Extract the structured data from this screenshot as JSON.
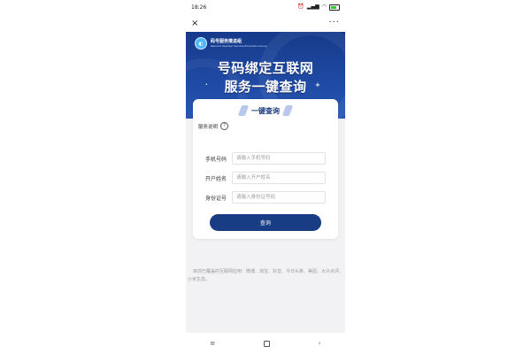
{
  "status_bar": {
    "time": "18:26",
    "icons": [
      "alarm-icon",
      "signal-icon",
      "wifi-icon",
      "battery-icon"
    ]
  },
  "title_bar": {
    "close_glyph": "×",
    "more_glyph": "···"
  },
  "banner": {
    "brand_name": "码号服务推进组",
    "brand_subtitle": "Telecom Number Service Promotion Group",
    "headline_line1": "号码绑定互联网",
    "headline_line2": "服务一键查询",
    "spark_left": "·",
    "spark_right": "+"
  },
  "card": {
    "title": "一键查询",
    "service_label": "服务说明",
    "help_glyph": "?",
    "fields": [
      {
        "label": "手机号码",
        "placeholder": "请输入手机号码",
        "value": ""
      },
      {
        "label": "开户姓名",
        "placeholder": "请输入开户姓名",
        "value": ""
      },
      {
        "label": "身份证号",
        "placeholder": "请输入身份证号码",
        "value": ""
      }
    ],
    "submit_label": "查询"
  },
  "footer": {
    "note": "目前已覆盖的互联网应用：微博、淘宝、抖音、今日头条、美团、大众点评、小米生态。"
  },
  "nav_bar": {
    "menu_glyph": "≡",
    "back_glyph": "‹"
  },
  "colors": {
    "banner_blue": "#1f4aa5",
    "button_blue": "#183d84",
    "title_blue": "#1c3b82"
  }
}
